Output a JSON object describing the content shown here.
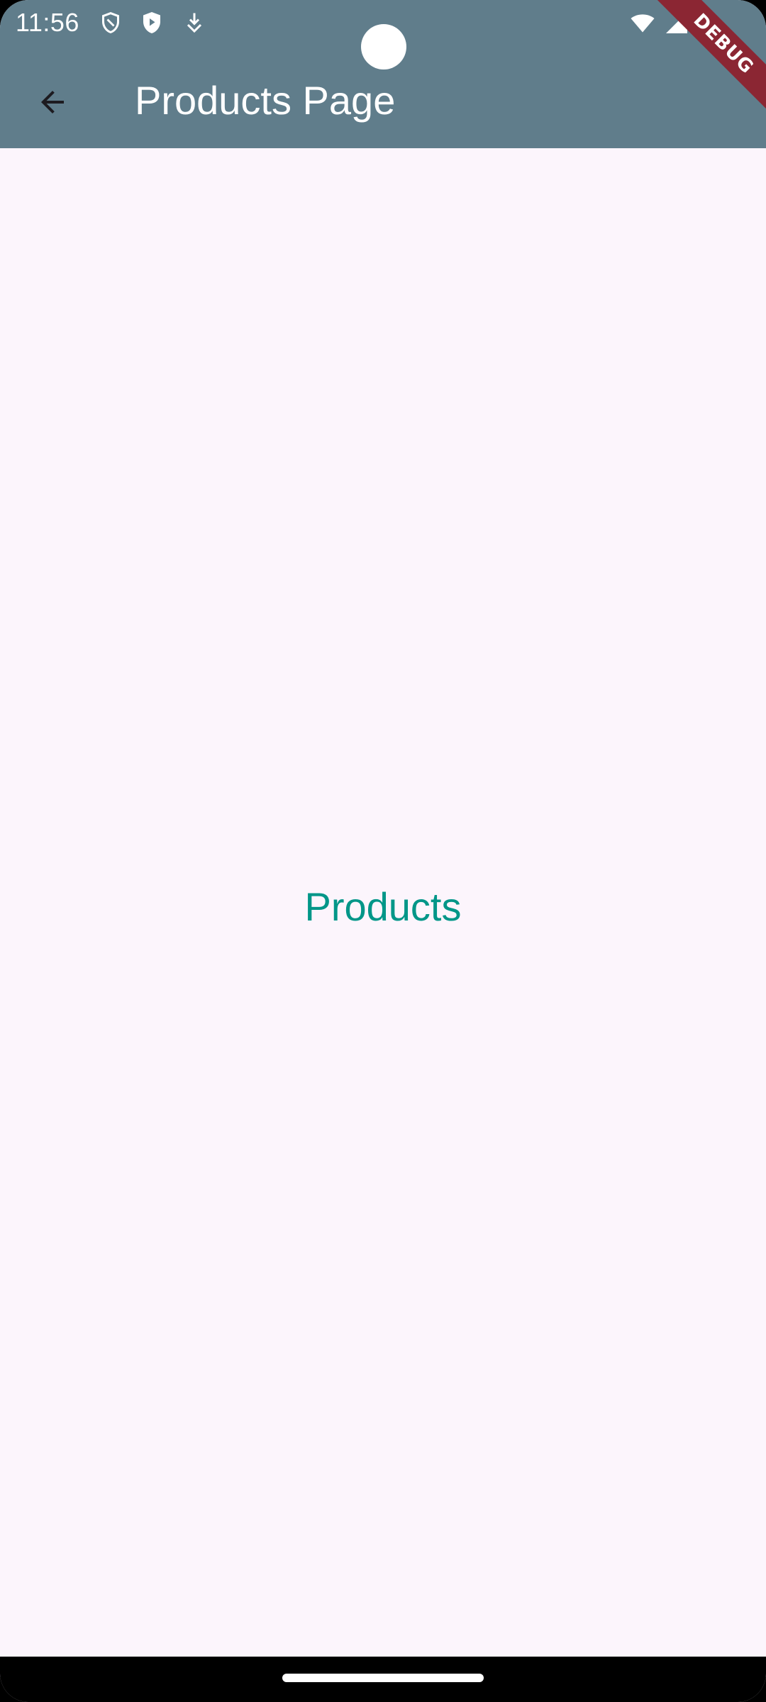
{
  "status_bar": {
    "time": "11:56",
    "left_icons": [
      "shield-outline-icon",
      "shield-play-icon",
      "download-icon"
    ],
    "right_icons": [
      "wifi-icon",
      "signal-icon",
      "battery-icon"
    ]
  },
  "app_bar": {
    "title": "Products Page",
    "back_icon": "arrow-back-icon",
    "background_color": "#607d8b"
  },
  "debug_banner": {
    "label": "DEBUG"
  },
  "main": {
    "text": "Products",
    "text_color": "#009688",
    "background_color": "#fcf5fc"
  }
}
